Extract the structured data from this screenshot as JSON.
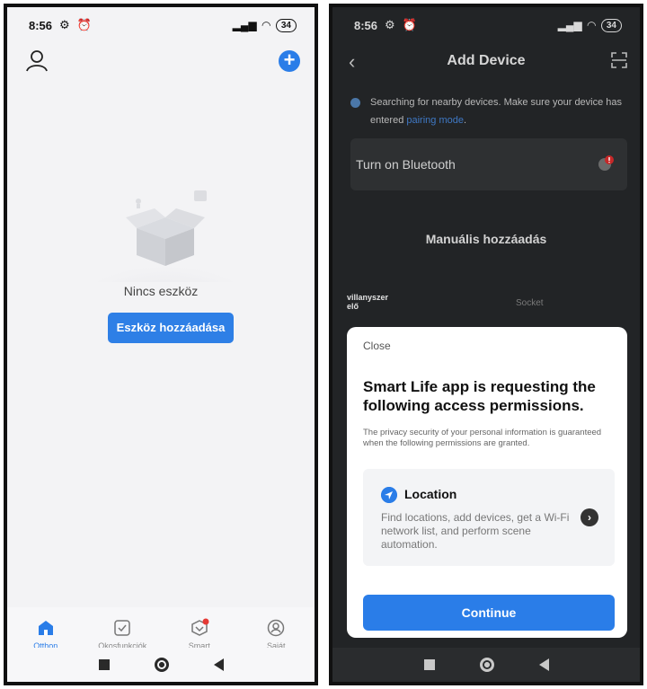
{
  "left": {
    "status": {
      "time": "8:56",
      "battery": "34"
    },
    "empty_text": "Nincs eszköz",
    "add_device_button": "Eszköz hozzáadása",
    "tabs": [
      {
        "label": "Otthon",
        "icon": "home-icon",
        "active": true
      },
      {
        "label": "Okosfunkciók",
        "icon": "checkbox-icon",
        "active": false
      },
      {
        "label": "Smart",
        "icon": "smart-icon",
        "active": false
      },
      {
        "label": "Saját",
        "icon": "profile-icon",
        "active": false
      }
    ]
  },
  "right": {
    "status": {
      "time": "8:56",
      "battery": "34"
    },
    "title": "Add Device",
    "searching_text": "Searching for nearby devices. Make sure your device has entered",
    "pairing_link": "pairing mode",
    "bluetooth_label": "Turn on Bluetooth",
    "manual_title": "Manuális hozzáadás",
    "category_left": "villanyszer elő",
    "category_right": "Socket",
    "sheet": {
      "close": "Close",
      "heading": "Smart Life app is requesting the following access permissions.",
      "description": "The privacy security of your personal information is guaranteed when the following permissions are granted.",
      "permission_title": "Location",
      "permission_desc": "Find locations, add devices, get a Wi-Fi network list, and perform scene automation.",
      "continue": "Continue"
    }
  },
  "colors": {
    "accent": "#2a7de8",
    "badge": "#e53935"
  }
}
